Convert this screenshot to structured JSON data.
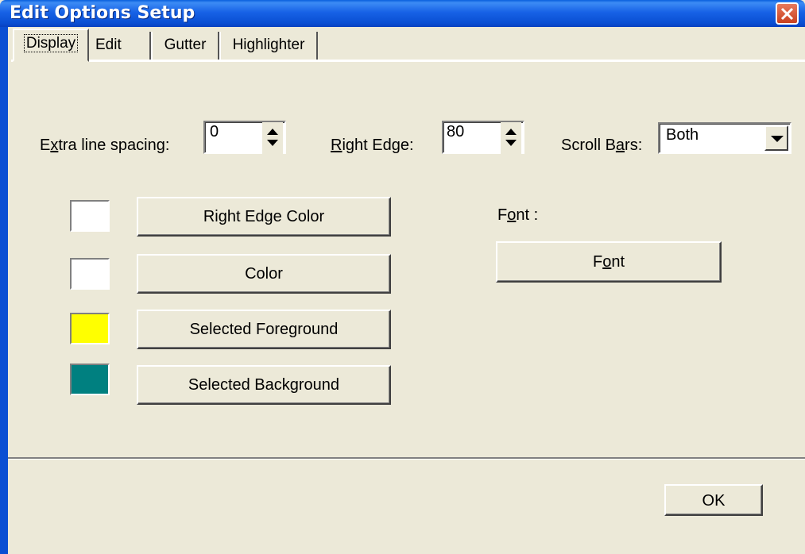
{
  "window": {
    "title": "Edit Options Setup"
  },
  "tabs": [
    {
      "label": "Display",
      "active": true
    },
    {
      "label": "Edit",
      "active": false
    },
    {
      "label": "Gutter",
      "active": false
    },
    {
      "label": "Highlighter",
      "active": false
    }
  ],
  "display": {
    "extra_line_spacing": {
      "label_pre": "E",
      "label_ul": "x",
      "label_post": "tra line spacing:",
      "value": "0"
    },
    "right_edge": {
      "label_pre": "",
      "label_ul": "R",
      "label_post": "ight Edge:",
      "value": "80"
    },
    "scroll_bars": {
      "label_pre": "Scroll B",
      "label_ul": "a",
      "label_post": "rs:",
      "value": "Both"
    },
    "colors": [
      {
        "button_label": "Right Edge Color",
        "swatch_color": "#ffffff"
      },
      {
        "button_label": "Color",
        "swatch_color": "#ffffff"
      },
      {
        "button_label": "Selected Foreground",
        "swatch_color": "#ffff00"
      },
      {
        "button_label": "Selected Background",
        "swatch_color": "#008080"
      }
    ],
    "font": {
      "label_pre": "F",
      "label_ul": "o",
      "label_post": "nt :",
      "button_pre": "F",
      "button_ul": "o",
      "button_post": "nt"
    }
  },
  "footer": {
    "ok_label": "OK"
  }
}
